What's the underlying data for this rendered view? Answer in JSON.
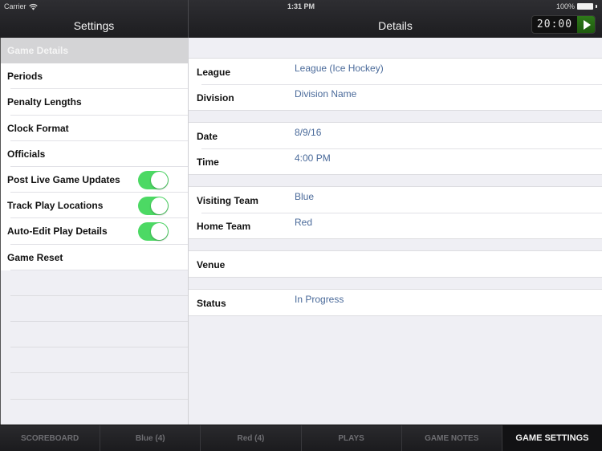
{
  "status_bar": {
    "carrier": "Carrier",
    "time": "1:31 PM",
    "battery": "100%"
  },
  "nav": {
    "left_title": "Settings",
    "right_title": "Details",
    "clock": "20:00"
  },
  "sidebar": {
    "items": [
      {
        "label": "Game Details",
        "selected": true
      },
      {
        "label": "Periods"
      },
      {
        "label": "Penalty Lengths"
      },
      {
        "label": "Clock Format"
      },
      {
        "label": "Officials"
      },
      {
        "label": "Post Live Game Updates",
        "toggle": true
      },
      {
        "label": "Track Play Locations",
        "toggle": true
      },
      {
        "label": "Auto-Edit Play Details",
        "toggle": true
      },
      {
        "label": "Game Reset"
      }
    ]
  },
  "details": {
    "groups": [
      [
        {
          "label": "League",
          "value": "League (Ice Hockey)"
        },
        {
          "label": "Division",
          "value": "Division Name"
        }
      ],
      [
        {
          "label": "Date",
          "value": "8/9/16"
        },
        {
          "label": "Time",
          "value": "4:00 PM"
        }
      ],
      [
        {
          "label": "Visiting Team",
          "value": "Blue"
        },
        {
          "label": "Home Team",
          "value": "Red"
        }
      ],
      [
        {
          "label": "Venue",
          "value": ""
        }
      ],
      [
        {
          "label": "Status",
          "value": "In Progress"
        }
      ]
    ]
  },
  "tabs": [
    {
      "label": "SCOREBOARD"
    },
    {
      "label": "Blue (4)"
    },
    {
      "label": "Red (4)"
    },
    {
      "label": "PLAYS"
    },
    {
      "label": "GAME NOTES"
    },
    {
      "label": "GAME SETTINGS",
      "active": true
    }
  ],
  "colors": {
    "toggle_on": "#4cd964",
    "value_text": "#4a6a9a",
    "play_button": "#2f7a1a"
  }
}
